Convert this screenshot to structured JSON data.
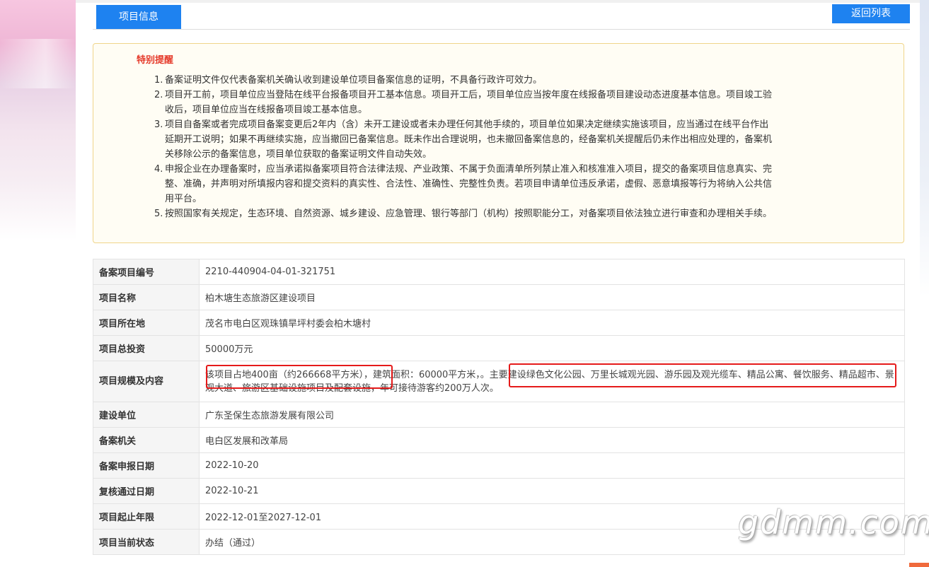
{
  "header": {
    "tab_label": "项目信息",
    "back_label": "返回列表"
  },
  "notice": {
    "title": "特别提醒",
    "items": [
      {
        "num": "1.",
        "text": "备案证明文件仅代表备案机关确认收到建设单位项目备案信息的证明，不具备行政许可效力。"
      },
      {
        "num": "2.",
        "text": "项目开工前，项目单位应当登陆在线平台报备项目开工基本信息。项目开工后，项目单位应当按年度在线报备项目建设动态进度基本信息。项目竣工验收后，项目单位应当在线报备项目竣工基本信息。"
      },
      {
        "num": "3.",
        "text": "项目自备案或者完成项目备案变更后2年内（含）未开工建设或者未办理任何其他手续的，项目单位如果决定继续实施该项目，应当通过在线平台作出延期开工说明；如果不再继续实施，应当撤回已备案信息。既未作出合理说明，也未撤回备案信息的，经备案机关提醒后仍未作出相应处理的，备案机关移除公示的备案信息，项目单位获取的备案证明文件自动失效。"
      },
      {
        "num": "4.",
        "text": "申报企业在办理备案时，应当承诺拟备案项目符合法律法规、产业政策、不属于负面清单所列禁止准入和核准准入项目，提交的备案项目信息真实、完整、准确，并声明对所填报内容和提交资料的真实性、合法性、准确性、完整性负责。若项目申请单位违反承诺，虚假、恶意填报等行为将纳入公共信用平台。"
      },
      {
        "num": "5.",
        "text": "按照国家有关规定，生态环境、自然资源、城乡建设、应急管理、银行等部门（机构）按照职能分工，对备案项目依法独立进行审查和办理相关手续。"
      }
    ]
  },
  "table": {
    "rows": [
      {
        "key": "备案项目编号",
        "value": "2210-440904-04-01-321751"
      },
      {
        "key": "项目名称",
        "value": "柏木塘生态旅游区建设项目"
      },
      {
        "key": "项目所在地",
        "value": "茂名市电白区观珠镇旱坪村委会柏木塘村"
      },
      {
        "key": "项目总投资",
        "value": "50000万元"
      },
      {
        "key": "项目规模及内容",
        "value": "该项目占地400亩（约266668平方米），建筑面积：60000平方米，。主要建设绿色文化公园、万里长城观光园、游乐园及观光缆车、精品公寓、餐饮服务、精品超市、景观大道、旅游区基础设施项目及配套设施，年可接待游客约200万人次。"
      },
      {
        "key": "建设单位",
        "value": "广东圣保生态旅游发展有限公司"
      },
      {
        "key": "备案机关",
        "value": "电白区发展和改革局"
      },
      {
        "key": "备案申报日期",
        "value": "2022-10-20"
      },
      {
        "key": "复核通过日期",
        "value": "2022-10-21"
      },
      {
        "key": "项目起止年限",
        "value": "2022-12-01至2027-12-01"
      },
      {
        "key": "项目当前状态",
        "value": "办结（通过）"
      }
    ]
  },
  "watermark": "gdmm.com",
  "colors": {
    "accent": "#1e82f0",
    "notice_title": "#e53a2a",
    "highlight": "#e51a1a"
  }
}
